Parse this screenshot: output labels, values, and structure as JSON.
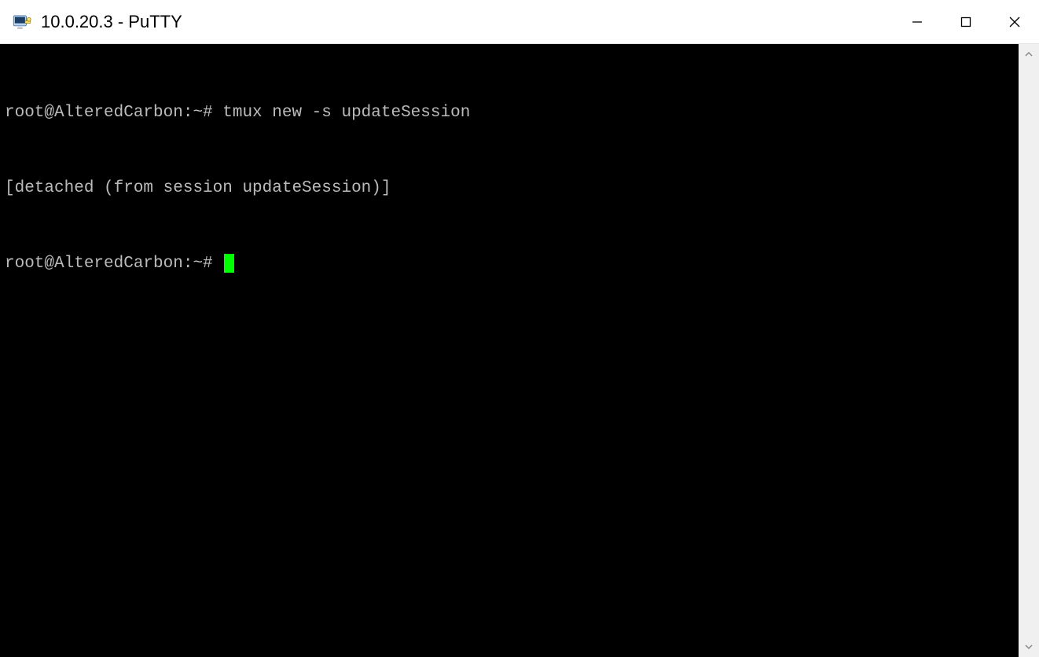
{
  "window": {
    "title": "10.0.20.3 - PuTTY"
  },
  "terminal": {
    "prompt": "root@AlteredCarbon:~#",
    "lines": {
      "l0": "root@AlteredCarbon:~# tmux new -s updateSession",
      "l1": "[detached (from session updateSession)]",
      "l2_prompt": "root@AlteredCarbon:~# "
    },
    "cursor_color": "#00ff00"
  }
}
